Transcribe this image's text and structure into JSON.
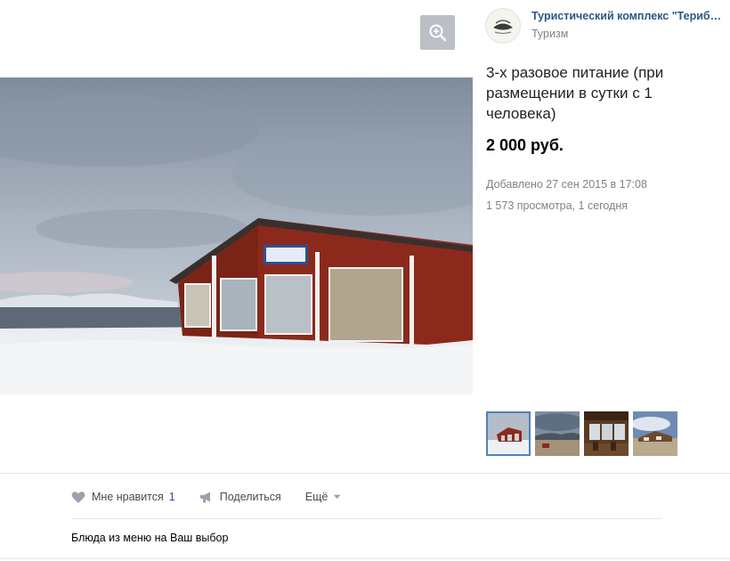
{
  "owner": {
    "name": "Туристический комплекс \"Териберка\"",
    "category": "Туризм"
  },
  "item": {
    "title": "3-х разовое питание (при размещении в сутки с 1 человека)",
    "price": "2 000 руб.",
    "added": "Добавлено 27 сен 2015 в 17:08",
    "views": "1 573 просмотра, 1 сегодня",
    "description": "Блюда из меню на Ваш выбор"
  },
  "actions": {
    "like_label": "Мне нравится",
    "like_count": "1",
    "share_label": "Поделиться",
    "more_label": "Ещё"
  },
  "icons": {
    "zoom": "zoom-in-icon",
    "like": "heart-icon",
    "share": "megaphone-icon",
    "more": "chevron-down-icon"
  },
  "colors": {
    "link": "#2a5885",
    "muted": "#828282",
    "zoom_bg": "#bcc0c6",
    "selected_thumb": "#5181b8"
  },
  "thumbnails_count": 4
}
